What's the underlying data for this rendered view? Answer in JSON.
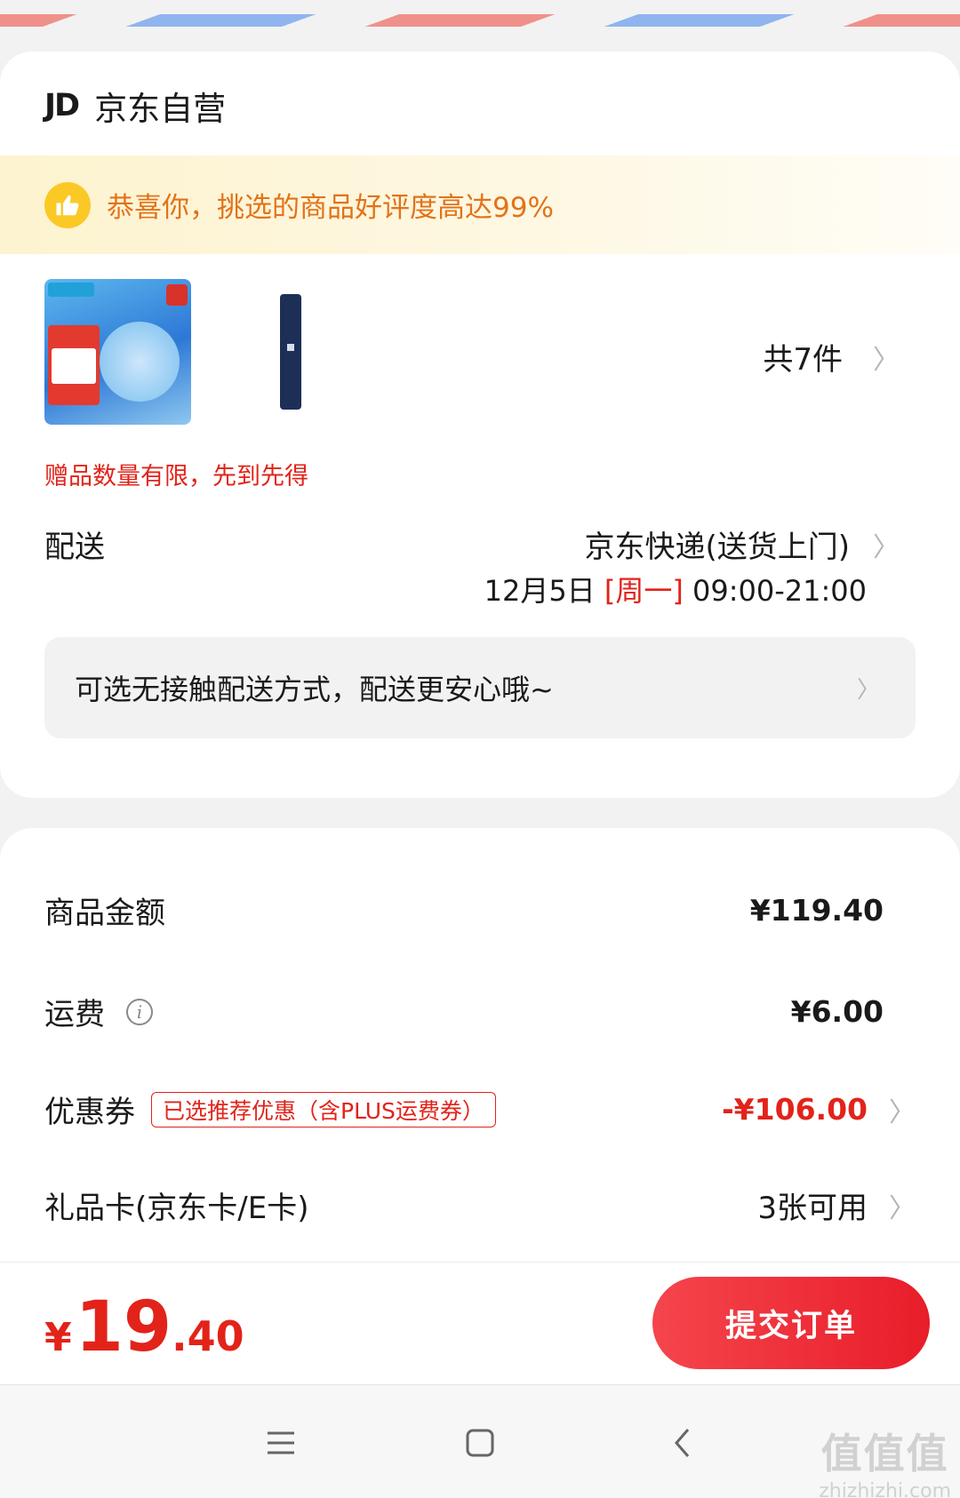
{
  "shop": {
    "logo": "JD",
    "name": "京东自营"
  },
  "praise": {
    "text": "恭喜你，挑选的商品好评度高达99%"
  },
  "products": {
    "count_label": "共7件"
  },
  "gift_note": "赠品数量有限，先到先得",
  "shipping": {
    "label": "配送",
    "method": "京东快递(送货上门)",
    "date": "12月5日",
    "weekday": "[周一]",
    "time": "09:00-21:00"
  },
  "contactless": {
    "text": "可选无接触配送方式，配送更安心哦~"
  },
  "fees": {
    "goods_label": "商品金额",
    "goods_value": "¥119.40",
    "freight_label": "运费",
    "freight_value": "¥6.00",
    "coupon_label": "优惠券",
    "coupon_tag": "已选推荐优惠（含PLUS运费券）",
    "coupon_value": "-¥106.00",
    "giftcard_label": "礼品卡(京东卡/E卡)",
    "giftcard_value": "3张可用"
  },
  "total": {
    "currency": "¥",
    "integer": "19",
    "decimal": ".40"
  },
  "submit_label": "提交订单",
  "watermark": {
    "big": "值值值",
    "small": "zhizhizhi.com"
  },
  "colors": {
    "accent_red": "#e2231a",
    "praise_orange": "#e2731a",
    "praise_icon": "#fbc926"
  },
  "icons": [
    "thumbs-up-icon",
    "chevron-right-icon",
    "info-icon",
    "menu-icon",
    "home-icon",
    "back-icon"
  ]
}
